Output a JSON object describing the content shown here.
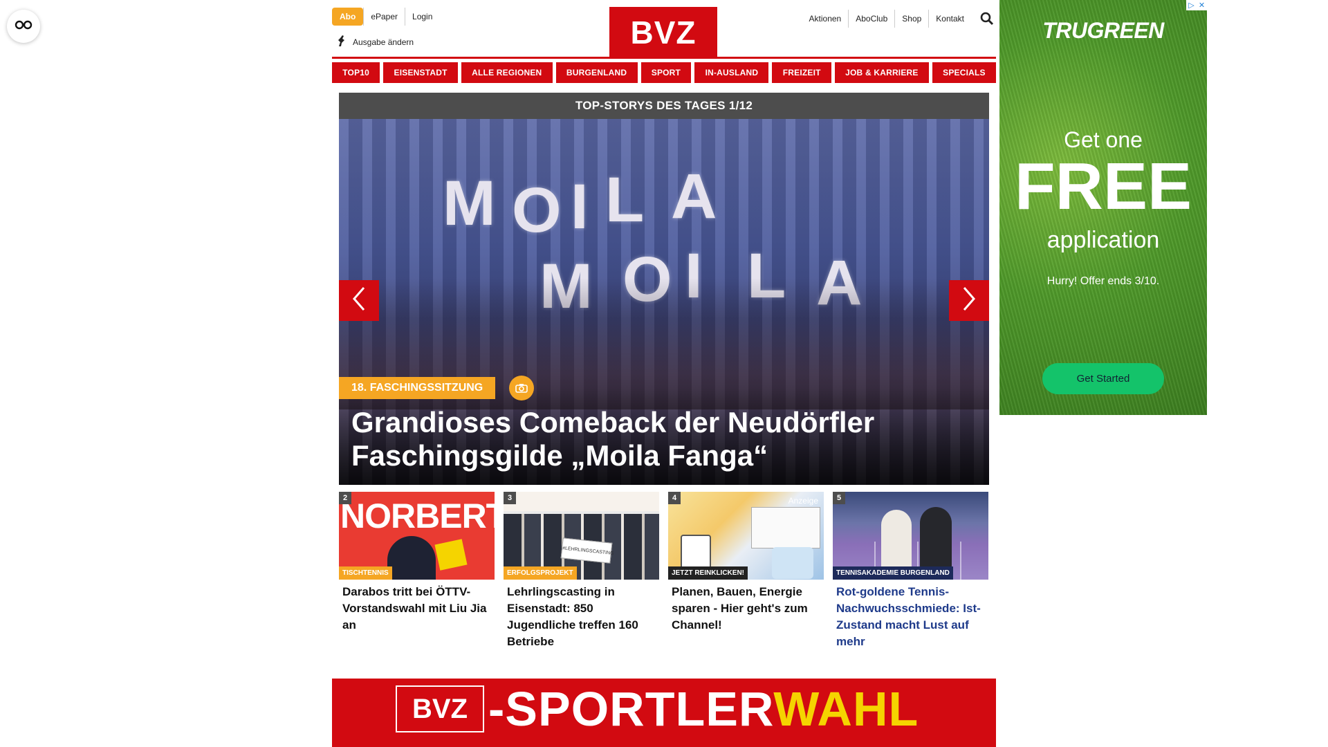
{
  "header": {
    "abo_label": "Abo",
    "epaper_label": "ePaper",
    "login_label": "Login",
    "ausgabe_label": "Ausgabe ändern",
    "logo_text": "BVZ",
    "right_links": [
      "Aktionen",
      "AboClub",
      "Shop",
      "Kontakt"
    ]
  },
  "nav": {
    "items": [
      "TOP10",
      "EISENSTADT",
      "ALLE REGIONEN",
      "BURGENLAND",
      "SPORT",
      "IN-AUSLAND",
      "FREIZEIT",
      "JOB & KARRIERE",
      "SPECIALS"
    ]
  },
  "hero": {
    "heading": "TOP-STORYS DES TAGES 1/12",
    "image_letters": [
      "M",
      "O",
      "I",
      "L",
      "A",
      "M",
      "O",
      "I",
      "L",
      "A"
    ],
    "kicker": "18. FASCHINGSSITZUNG",
    "title": "Grandioses Comeback der Neudörfler Faschingsgilde „Moila Fanga“"
  },
  "teasers": [
    {
      "num": "2",
      "tag": "TISCHTENNIS",
      "title": "Darabos tritt bei ÖTTV-Vorstandswahl mit Liu Jia an",
      "image_text": "NORBERT"
    },
    {
      "num": "3",
      "tag": "ERFOLGSPROJEKT",
      "title": "Lehrlingscasting in Eisenstadt: 850 Jugendliche treffen 160 Betriebe",
      "image_text": "#LEHRLINGSCASTING"
    },
    {
      "num": "4",
      "tag": "JETZT REINKLICKEN!",
      "title": "Planen, Bauen, Energie sparen - Hier geht's zum Channel!",
      "image_text": "Anzeige"
    },
    {
      "num": "5",
      "tag": "TENNISAKADEMIE BURGENLAND",
      "title": "Rot-goldene Tennis-Nachwuchsschmiede: Ist-Zustand macht Lust auf mehr"
    }
  ],
  "sport_banner": {
    "logo_text": "BVZ",
    "text_white": "-SPORTLER",
    "text_yellow": "WAHL"
  },
  "ad": {
    "brand": "TRUGREEN",
    "line1": "Get one",
    "line2": "FREE",
    "line3": "application",
    "hurry": "Hurry! Offer ends 3/10.",
    "cta": "Get Started",
    "choices_icons": [
      "ad-choices-icon",
      "close-icon"
    ]
  },
  "colors": {
    "brand_red": "#d20a11",
    "accent_orange": "#f5a623",
    "dark_grey": "#4d4d4d",
    "ad_green": "#14c36a",
    "link_blue": "#1e3a8a"
  }
}
